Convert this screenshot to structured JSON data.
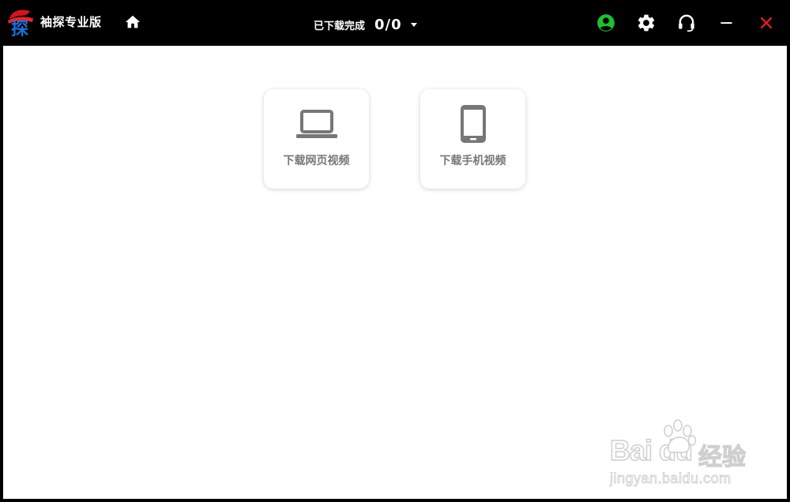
{
  "app": {
    "title": "袖探专业版"
  },
  "titlebar": {
    "download_status_label": "已下载完成",
    "download_count": "0/0",
    "icons": {
      "home": "home-icon",
      "user": "user-circle-icon",
      "settings": "gear-icon",
      "support": "headset-icon",
      "minimize": "minimize-icon",
      "close": "close-icon"
    },
    "colors": {
      "user_icon": "#1fbf2f",
      "close_icon": "#e02020",
      "background": "#000000"
    }
  },
  "main": {
    "cards": [
      {
        "label": "下载网页视频",
        "icon": "laptop-icon"
      },
      {
        "label": "下载手机视频",
        "icon": "smartphone-icon"
      }
    ]
  },
  "watermark": {
    "brand": "Bai du",
    "cn": "经验",
    "url": "jingyan.baidu.com"
  }
}
